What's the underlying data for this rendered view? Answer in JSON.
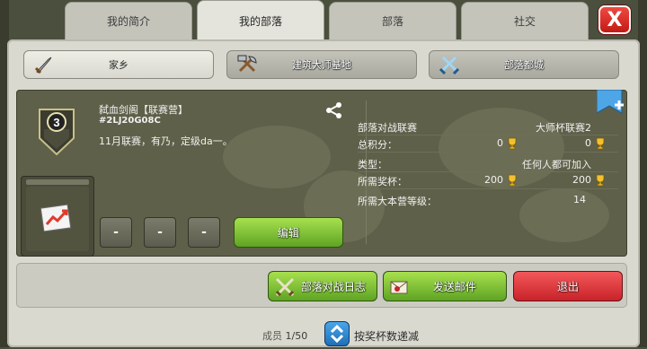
{
  "tabs": [
    {
      "label": "我的简介",
      "active": false
    },
    {
      "label": "我的部落",
      "active": true
    },
    {
      "label": "部落",
      "active": false
    },
    {
      "label": "社交",
      "active": false
    }
  ],
  "close_button": {
    "label": "X"
  },
  "subtabs": [
    {
      "label": "家乡",
      "icon": "sword-icon",
      "active": true
    },
    {
      "label": "建筑大师基地",
      "icon": "hammer-axe-icon",
      "active": false
    },
    {
      "label": "部落都城",
      "icon": "crossed-swords-icon",
      "active": false
    }
  ],
  "clan": {
    "level": "3",
    "name": "弑血剑阁【联赛营】",
    "tag": "#2LJ20G08C",
    "description": "11月联赛，有乃，定级da一。"
  },
  "stats": {
    "league_label": "部落对战联赛",
    "league_value": "大师杯联赛2",
    "total_points_label": "总积分：",
    "total_points_home": "0",
    "total_points_builder": "0",
    "type_label": "类型：",
    "type_value": "任何人都可加入",
    "required_trophies_label": "所需奖杯：",
    "required_trophies_home": "200",
    "required_trophies_builder": "200",
    "required_th_label": "所需大本营等级：",
    "required_th_value": "14"
  },
  "dash_buttons": [
    "-",
    "-",
    "-"
  ],
  "edit_button": {
    "label": "编辑"
  },
  "actions": {
    "war_log": "部落对战日志",
    "send_mail": "发送邮件",
    "leave": "退出"
  },
  "members": {
    "label": "成员",
    "count": "1/50"
  },
  "sort": {
    "label": "按奖杯数递减"
  },
  "colors": {
    "primary_green": "#5fa424",
    "danger_red": "#c8232a",
    "panel_bg": "#d9d9d0",
    "info_bg": "#5f6049",
    "trophy_gold": "#f2c12e"
  }
}
